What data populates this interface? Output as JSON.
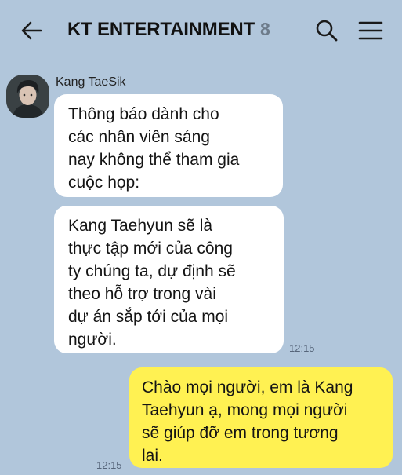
{
  "header": {
    "title": "KT ENTERTAINMENT",
    "member_count": "8",
    "back_icon": "arrow-left-icon",
    "search_icon": "search-icon",
    "menu_icon": "hamburger-menu-icon"
  },
  "messages": [
    {
      "sender": "Kang TaeSik",
      "bubbles": [
        {
          "lines": [
            "Thông báo dành cho",
            "các nhân viên sáng",
            "nay không thể tham gia",
            "cuộc họp:"
          ]
        },
        {
          "lines": [
            "Kang Taehyun sẽ là",
            "thực tập mới của công",
            "ty chúng ta, dự định sẽ",
            "theo hỗ trợ trong vài",
            "dự án sắp tới của mọi",
            "người."
          ]
        }
      ],
      "time": "12:15"
    },
    {
      "lines": [
        "Chào mọi người, em là Kang",
        "Taehyun ạ, mong mọi người",
        "sẽ giúp đỡ em trong tương",
        "lai."
      ],
      "time": "12:15"
    }
  ],
  "colors": {
    "background": "#b1c6db",
    "incoming_bubble": "#ffffff",
    "outgoing_bubble": "#fff152"
  }
}
